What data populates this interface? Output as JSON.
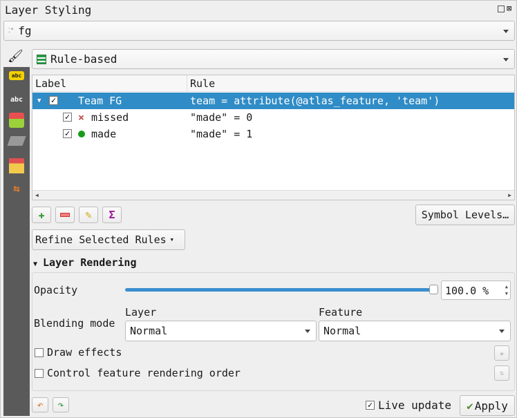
{
  "panel_title": "Layer Styling",
  "layer_select": {
    "value": "fg",
    "icon": "point-layer-icon"
  },
  "renderer": {
    "value": "Rule-based",
    "icon": "rule-based-icon"
  },
  "tree": {
    "headers": [
      "Label",
      "Rule"
    ],
    "rows": [
      {
        "label": "Team FG",
        "rule": "team =  attribute(@atlas_feature, 'team')",
        "checked": true,
        "selected": true,
        "symbol": "none"
      },
      {
        "label": "missed",
        "rule": "\"made\" = 0",
        "checked": true,
        "symbol": "red-cross",
        "color": "#c0504d"
      },
      {
        "label": "made",
        "rule": "\"made\" = 1",
        "checked": true,
        "symbol": "green-circle",
        "color": "#1a9c1a"
      }
    ]
  },
  "toolbar": {
    "symbol_levels": "Symbol Levels…",
    "refine": "Refine Selected Rules"
  },
  "rendering": {
    "section_title": "Layer Rendering",
    "opacity_label": "Opacity",
    "opacity_value": "100.0 %",
    "opacity_fraction": 1.0,
    "blending_label": "Blending mode",
    "layer_label": "Layer",
    "layer_value": "Normal",
    "feature_label": "Feature",
    "feature_value": "Normal",
    "draw_effects": "Draw effects",
    "control_order": "Control feature rendering order"
  },
  "footer": {
    "live_update": "Live update",
    "apply": "Apply"
  },
  "colors": {
    "selection": "#308cc6",
    "accent": "#3a8fd0"
  }
}
